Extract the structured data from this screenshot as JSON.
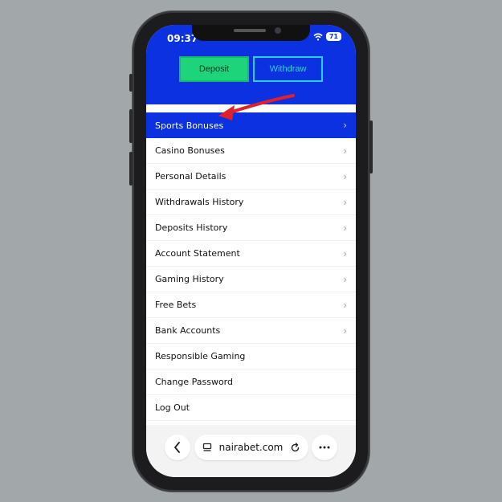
{
  "status": {
    "time": "09:37",
    "battery": "71"
  },
  "header": {
    "deposit_label": "Deposit",
    "withdraw_label": "Withdraw"
  },
  "menu": {
    "items": [
      {
        "label": "Sports Bonuses",
        "chevron": true,
        "active": true
      },
      {
        "label": "Casino Bonuses",
        "chevron": true
      },
      {
        "label": "Personal Details",
        "chevron": true
      },
      {
        "label": "Withdrawals History",
        "chevron": true
      },
      {
        "label": "Deposits History",
        "chevron": true
      },
      {
        "label": "Account Statement",
        "chevron": true
      },
      {
        "label": "Gaming History",
        "chevron": true
      },
      {
        "label": "Free Bets",
        "chevron": true
      },
      {
        "label": "Bank Accounts",
        "chevron": true
      },
      {
        "label": "Responsible Gaming",
        "chevron": false
      },
      {
        "label": "Change Password",
        "chevron": false
      },
      {
        "label": "Log Out",
        "chevron": false
      }
    ]
  },
  "browser": {
    "url": "nairabet.com"
  },
  "colors": {
    "brand_blue": "#0b31e0",
    "deposit_green": "#1ed47a",
    "withdraw_cyan": "#26d2d6",
    "annotation_red": "#e0202b"
  }
}
